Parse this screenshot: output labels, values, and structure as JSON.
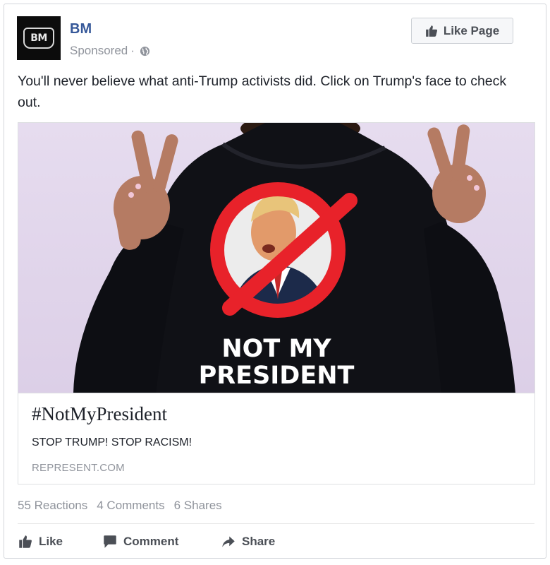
{
  "post": {
    "avatar_text": "BM",
    "page_name": "BM",
    "sponsored_label": "Sponsored",
    "dot": "·",
    "like_page_label": "Like Page",
    "text": "You'll never believe what anti-Trump activists did. Click on Trump's face to check out."
  },
  "link_card": {
    "image": {
      "shirt_line_1": "NOT MY",
      "shirt_line_2": "PRESIDENT"
    },
    "title": "#NotMyPresident",
    "description": "STOP TRUMP! STOP RACISM!",
    "domain": "REPRESENT.COM"
  },
  "stats": {
    "reactions": "55 Reactions",
    "comments": "4 Comments",
    "shares": "6 Shares"
  },
  "actions": {
    "like": "Like",
    "comment": "Comment",
    "share": "Share"
  },
  "icons": {
    "globe": "globe-icon",
    "thumbs_up": "thumbs-up-icon",
    "comment": "comment-bubble-icon",
    "share": "share-arrow-icon"
  },
  "colors": {
    "link_blue": "#365899",
    "meta_gray": "#90949c",
    "action_gray": "#4b4f56",
    "prohibition_red": "#e8222a"
  }
}
